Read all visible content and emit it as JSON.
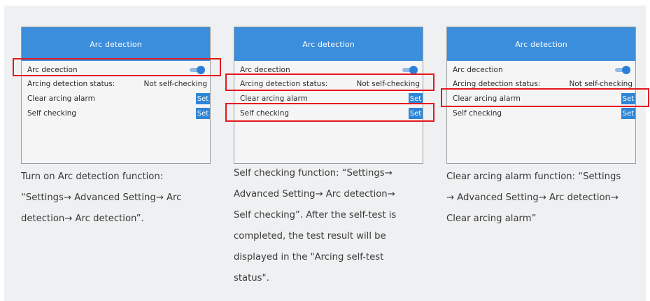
{
  "panel_title": "Arc detection",
  "rows": {
    "arc_detection": "Arc decection",
    "status_label": "Arcing detection status:",
    "status_value": "Not self-checking",
    "clear_alarm": "Clear arcing alarm",
    "self_checking": "Self checking"
  },
  "set_label": "Set",
  "toggle_state": "on",
  "colors": {
    "header": "#3b8edb",
    "highlight": "#e5171d",
    "button": "#2f86d6"
  },
  "descriptions": [
    [
      "Turn on Arc detection function:",
      "“Settings→ Advanced Setting→ Arc",
      "detection→ Arc detection”."
    ],
    [
      "Self checking function: “Settings→",
      "Advanced Setting→ Arc detection→",
      "Self checking”. After the self-test is",
      "completed, the test result will be",
      "displayed in the \"Arcing self-test",
      "status\"."
    ],
    [
      "Clear arcing alarm function: “Settings",
      "→ Advanced Setting→ Arc detection→",
      "Clear arcing alarm”"
    ]
  ]
}
